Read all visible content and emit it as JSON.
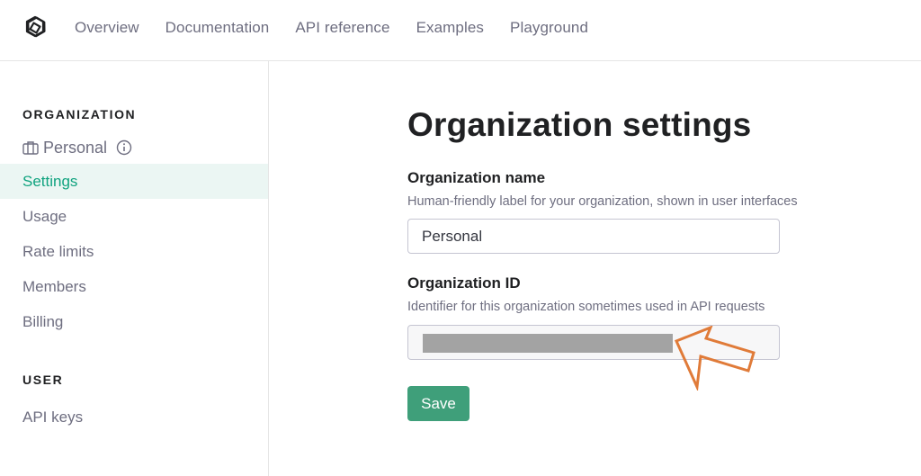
{
  "nav": {
    "items": [
      "Overview",
      "Documentation",
      "API reference",
      "Examples",
      "Playground"
    ]
  },
  "sidebar": {
    "org_heading": "ORGANIZATION",
    "org_name": "Personal",
    "items": [
      "Settings",
      "Usage",
      "Rate limits",
      "Members",
      "Billing"
    ],
    "active_item": "Settings",
    "user_heading": "USER",
    "user_items": [
      "API keys"
    ]
  },
  "main": {
    "title": "Organization settings",
    "org_name_label": "Organization name",
    "org_name_help": "Human-friendly label for your organization, shown in user interfaces",
    "org_name_value": "Personal",
    "org_id_label": "Organization ID",
    "org_id_help": "Identifier for this organization sometimes used in API requests",
    "save_label": "Save"
  },
  "icons": {
    "logo": "openai-logo-icon",
    "org": "briefcase-icon",
    "info": "info-icon",
    "annotation": "arrow-annotation-icon"
  },
  "colors": {
    "accent": "#10a37f",
    "active_bg": "#ebf6f3",
    "save_button": "#3f9f7a",
    "muted_text": "#6e6e80",
    "annotation_arrow": "#e07b39",
    "redaction": "#a3a3a3"
  }
}
